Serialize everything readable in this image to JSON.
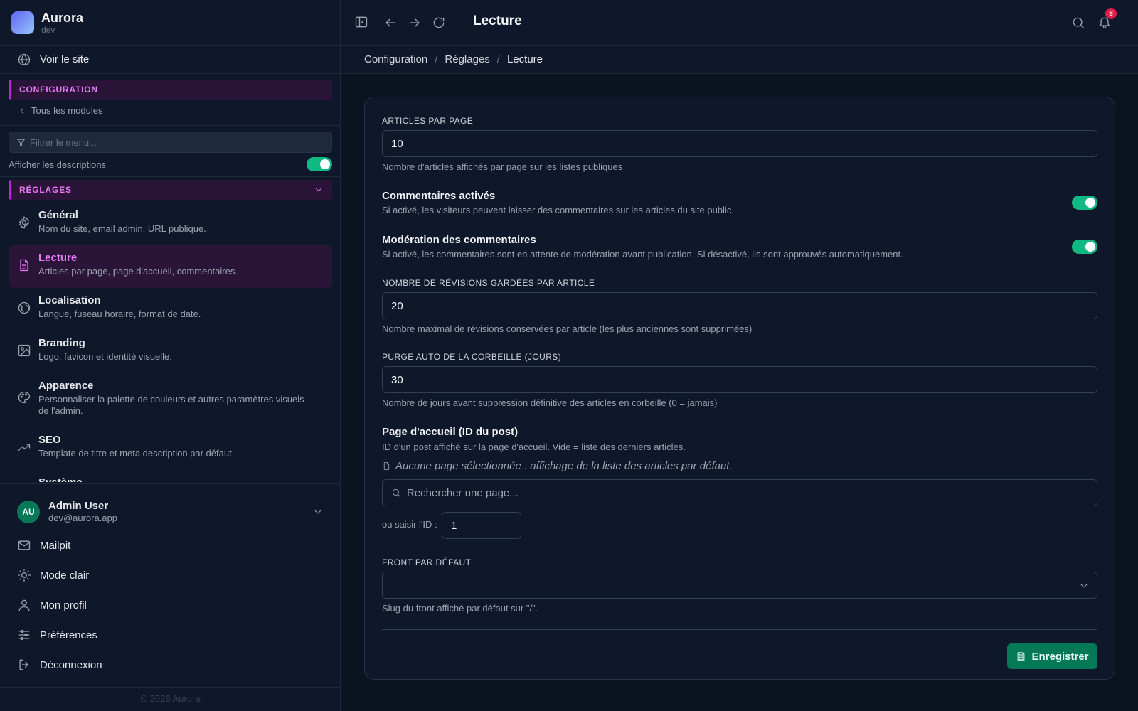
{
  "app": {
    "name": "Aurora",
    "env": "dev"
  },
  "sidebar": {
    "visit_site": "Voir le site",
    "section_config": "CONFIGURATION",
    "back_link": "Tous les modules",
    "filter_placeholder": "Filtrer le menu...",
    "show_descriptions": "Afficher les descriptions",
    "show_descriptions_on": true,
    "section_settings": "RÉGLAGES",
    "items": [
      {
        "title": "Général",
        "desc": "Nom du site, email admin, URL publique.",
        "icon": "gear-icon"
      },
      {
        "title": "Lecture",
        "desc": "Articles par page, page d'accueil, commentaires.",
        "icon": "document-icon",
        "active": true
      },
      {
        "title": "Localisation",
        "desc": "Langue, fuseau horaire, format de date.",
        "icon": "globe-icon"
      },
      {
        "title": "Branding",
        "desc": "Logo, favicon et identité visuelle.",
        "icon": "image-icon"
      },
      {
        "title": "Apparence",
        "desc": "Personnaliser la palette de couleurs et autres paramètres visuels de l'admin.",
        "icon": "palette-icon"
      },
      {
        "title": "SEO",
        "desc": "Template de titre et meta description par défaut.",
        "icon": "trending-icon"
      },
      {
        "title": "Système",
        "desc": "",
        "icon": "server-icon"
      }
    ],
    "user": {
      "initials": "AU",
      "name": "Admin User",
      "email": "dev@aurora.app"
    },
    "links": [
      "Mailpit",
      "Mode clair",
      "Mon profil",
      "Préférences",
      "Déconnexion"
    ],
    "copyright": "© 2026 Aurora"
  },
  "topbar": {
    "title": "Lecture",
    "notifications": "8"
  },
  "breadcrumb": [
    "Configuration",
    "Réglages",
    "Lecture"
  ],
  "form": {
    "articles_label": "ARTICLES PAR PAGE",
    "articles_value": "10",
    "articles_help": "Nombre d'articles affichés par page sur les listes publiques",
    "comments_title": "Commentaires activés",
    "comments_desc": "Si activé, les visiteurs peuvent laisser des commentaires sur les articles du site public.",
    "comments_on": true,
    "moderation_title": "Modération des commentaires",
    "moderation_desc": "Si activé, les commentaires sont en attente de modération avant publication. Si désactivé, ils sont approuvés automatiquement.",
    "moderation_on": true,
    "revisions_label": "NOMBRE DE RÉVISIONS GARDÉES PAR ARTICLE",
    "revisions_value": "20",
    "revisions_help": "Nombre maximal de révisions conservées par article (les plus anciennes sont supprimées)",
    "trash_label": "PURGE AUTO DE LA CORBEILLE (JOURS)",
    "trash_value": "30",
    "trash_help": "Nombre de jours avant suppression définitive des articles en corbeille (0 = jamais)",
    "homepage_title": "Page d'accueil (ID du post)",
    "homepage_desc": "ID d'un post affiché sur la page d'accueil. Vide = liste des derniers articles.",
    "homepage_empty": "Aucune page sélectionnée : affichage de la liste des articles par défaut.",
    "homepage_search_placeholder": "Rechercher une page...",
    "homepage_id_label": "ou saisir l'ID :",
    "homepage_id_value": "1",
    "front_label": "FRONT PAR DÉFAUT",
    "front_value": "",
    "front_help": "Slug du front affiché par défaut sur \"/\".",
    "save_label": "Enregistrer"
  },
  "colors": {
    "accent": "#e879f9",
    "success": "#10b981",
    "save": "#047857",
    "badge": "#e11d48"
  }
}
